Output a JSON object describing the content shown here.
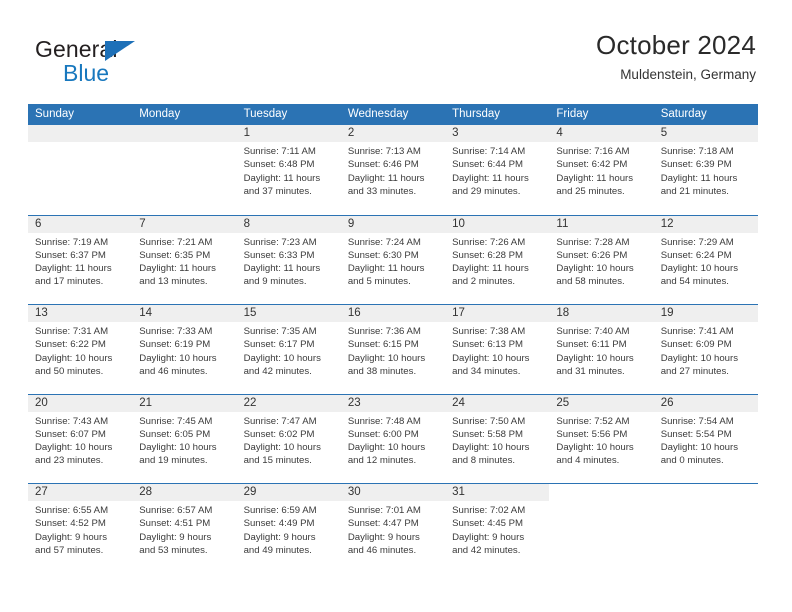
{
  "brand": {
    "name_part1": "General",
    "name_part2": "Blue"
  },
  "header": {
    "title": "October 2024",
    "subtitle": "Muldenstein, Germany"
  },
  "colors": {
    "header_blue": "#2b73b4",
    "brand_blue": "#1878be",
    "daynum_strip": "#efefef",
    "text": "#3b3b3b"
  },
  "weekdays": [
    "Sunday",
    "Monday",
    "Tuesday",
    "Wednesday",
    "Thursday",
    "Friday",
    "Saturday"
  ],
  "labels": {
    "sunrise": "Sunrise:",
    "sunset": "Sunset:",
    "daylight": "Daylight:"
  },
  "weeks": [
    [
      {
        "day": "",
        "empty": true
      },
      {
        "day": "",
        "empty": true
      },
      {
        "day": "1",
        "sunrise": "Sunrise: 7:11 AM",
        "sunset": "Sunset: 6:48 PM",
        "daylight1": "Daylight: 11 hours",
        "daylight2": "and 37 minutes."
      },
      {
        "day": "2",
        "sunrise": "Sunrise: 7:13 AM",
        "sunset": "Sunset: 6:46 PM",
        "daylight1": "Daylight: 11 hours",
        "daylight2": "and 33 minutes."
      },
      {
        "day": "3",
        "sunrise": "Sunrise: 7:14 AM",
        "sunset": "Sunset: 6:44 PM",
        "daylight1": "Daylight: 11 hours",
        "daylight2": "and 29 minutes."
      },
      {
        "day": "4",
        "sunrise": "Sunrise: 7:16 AM",
        "sunset": "Sunset: 6:42 PM",
        "daylight1": "Daylight: 11 hours",
        "daylight2": "and 25 minutes."
      },
      {
        "day": "5",
        "sunrise": "Sunrise: 7:18 AM",
        "sunset": "Sunset: 6:39 PM",
        "daylight1": "Daylight: 11 hours",
        "daylight2": "and 21 minutes."
      }
    ],
    [
      {
        "day": "6",
        "sunrise": "Sunrise: 7:19 AM",
        "sunset": "Sunset: 6:37 PM",
        "daylight1": "Daylight: 11 hours",
        "daylight2": "and 17 minutes."
      },
      {
        "day": "7",
        "sunrise": "Sunrise: 7:21 AM",
        "sunset": "Sunset: 6:35 PM",
        "daylight1": "Daylight: 11 hours",
        "daylight2": "and 13 minutes."
      },
      {
        "day": "8",
        "sunrise": "Sunrise: 7:23 AM",
        "sunset": "Sunset: 6:33 PM",
        "daylight1": "Daylight: 11 hours",
        "daylight2": "and 9 minutes."
      },
      {
        "day": "9",
        "sunrise": "Sunrise: 7:24 AM",
        "sunset": "Sunset: 6:30 PM",
        "daylight1": "Daylight: 11 hours",
        "daylight2": "and 5 minutes."
      },
      {
        "day": "10",
        "sunrise": "Sunrise: 7:26 AM",
        "sunset": "Sunset: 6:28 PM",
        "daylight1": "Daylight: 11 hours",
        "daylight2": "and 2 minutes."
      },
      {
        "day": "11",
        "sunrise": "Sunrise: 7:28 AM",
        "sunset": "Sunset: 6:26 PM",
        "daylight1": "Daylight: 10 hours",
        "daylight2": "and 58 minutes."
      },
      {
        "day": "12",
        "sunrise": "Sunrise: 7:29 AM",
        "sunset": "Sunset: 6:24 PM",
        "daylight1": "Daylight: 10 hours",
        "daylight2": "and 54 minutes."
      }
    ],
    [
      {
        "day": "13",
        "sunrise": "Sunrise: 7:31 AM",
        "sunset": "Sunset: 6:22 PM",
        "daylight1": "Daylight: 10 hours",
        "daylight2": "and 50 minutes."
      },
      {
        "day": "14",
        "sunrise": "Sunrise: 7:33 AM",
        "sunset": "Sunset: 6:19 PM",
        "daylight1": "Daylight: 10 hours",
        "daylight2": "and 46 minutes."
      },
      {
        "day": "15",
        "sunrise": "Sunrise: 7:35 AM",
        "sunset": "Sunset: 6:17 PM",
        "daylight1": "Daylight: 10 hours",
        "daylight2": "and 42 minutes."
      },
      {
        "day": "16",
        "sunrise": "Sunrise: 7:36 AM",
        "sunset": "Sunset: 6:15 PM",
        "daylight1": "Daylight: 10 hours",
        "daylight2": "and 38 minutes."
      },
      {
        "day": "17",
        "sunrise": "Sunrise: 7:38 AM",
        "sunset": "Sunset: 6:13 PM",
        "daylight1": "Daylight: 10 hours",
        "daylight2": "and 34 minutes."
      },
      {
        "day": "18",
        "sunrise": "Sunrise: 7:40 AM",
        "sunset": "Sunset: 6:11 PM",
        "daylight1": "Daylight: 10 hours",
        "daylight2": "and 31 minutes."
      },
      {
        "day": "19",
        "sunrise": "Sunrise: 7:41 AM",
        "sunset": "Sunset: 6:09 PM",
        "daylight1": "Daylight: 10 hours",
        "daylight2": "and 27 minutes."
      }
    ],
    [
      {
        "day": "20",
        "sunrise": "Sunrise: 7:43 AM",
        "sunset": "Sunset: 6:07 PM",
        "daylight1": "Daylight: 10 hours",
        "daylight2": "and 23 minutes."
      },
      {
        "day": "21",
        "sunrise": "Sunrise: 7:45 AM",
        "sunset": "Sunset: 6:05 PM",
        "daylight1": "Daylight: 10 hours",
        "daylight2": "and 19 minutes."
      },
      {
        "day": "22",
        "sunrise": "Sunrise: 7:47 AM",
        "sunset": "Sunset: 6:02 PM",
        "daylight1": "Daylight: 10 hours",
        "daylight2": "and 15 minutes."
      },
      {
        "day": "23",
        "sunrise": "Sunrise: 7:48 AM",
        "sunset": "Sunset: 6:00 PM",
        "daylight1": "Daylight: 10 hours",
        "daylight2": "and 12 minutes."
      },
      {
        "day": "24",
        "sunrise": "Sunrise: 7:50 AM",
        "sunset": "Sunset: 5:58 PM",
        "daylight1": "Daylight: 10 hours",
        "daylight2": "and 8 minutes."
      },
      {
        "day": "25",
        "sunrise": "Sunrise: 7:52 AM",
        "sunset": "Sunset: 5:56 PM",
        "daylight1": "Daylight: 10 hours",
        "daylight2": "and 4 minutes."
      },
      {
        "day": "26",
        "sunrise": "Sunrise: 7:54 AM",
        "sunset": "Sunset: 5:54 PM",
        "daylight1": "Daylight: 10 hours",
        "daylight2": "and 0 minutes."
      }
    ],
    [
      {
        "day": "27",
        "sunrise": "Sunrise: 6:55 AM",
        "sunset": "Sunset: 4:52 PM",
        "daylight1": "Daylight: 9 hours",
        "daylight2": "and 57 minutes."
      },
      {
        "day": "28",
        "sunrise": "Sunrise: 6:57 AM",
        "sunset": "Sunset: 4:51 PM",
        "daylight1": "Daylight: 9 hours",
        "daylight2": "and 53 minutes."
      },
      {
        "day": "29",
        "sunrise": "Sunrise: 6:59 AM",
        "sunset": "Sunset: 4:49 PM",
        "daylight1": "Daylight: 9 hours",
        "daylight2": "and 49 minutes."
      },
      {
        "day": "30",
        "sunrise": "Sunrise: 7:01 AM",
        "sunset": "Sunset: 4:47 PM",
        "daylight1": "Daylight: 9 hours",
        "daylight2": "and 46 minutes."
      },
      {
        "day": "31",
        "sunrise": "Sunrise: 7:02 AM",
        "sunset": "Sunset: 4:45 PM",
        "daylight1": "Daylight: 9 hours",
        "daylight2": "and 42 minutes."
      },
      {
        "day": "",
        "blank": true
      },
      {
        "day": "",
        "blank": true
      }
    ]
  ]
}
